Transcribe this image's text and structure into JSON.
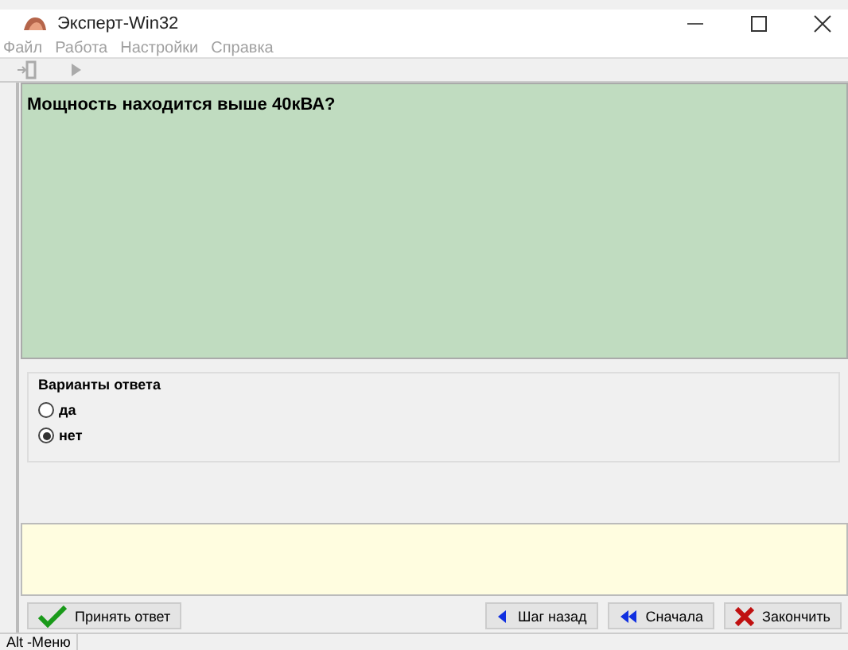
{
  "window": {
    "title": "Эксперт-Win32"
  },
  "menu": [
    {
      "label": "Файл",
      "disabled": true
    },
    {
      "label": "Работа",
      "disabled": true
    },
    {
      "label": "Настройки",
      "disabled": true
    },
    {
      "label": "Справка",
      "disabled": true
    }
  ],
  "question": "Мощность находится выше 40кВА?",
  "answers": {
    "title": "Варианты ответа",
    "options": [
      {
        "label": "да",
        "selected": false
      },
      {
        "label": "нет",
        "selected": true
      }
    ]
  },
  "buttons": [
    {
      "label": "Принять ответ",
      "kind": "accept"
    },
    {
      "label": "Шаг назад",
      "kind": "back"
    },
    {
      "label": "Сначала",
      "kind": "first"
    },
    {
      "label": "Закончить",
      "kind": "finish"
    }
  ],
  "status_bar": "Alt -Меню"
}
